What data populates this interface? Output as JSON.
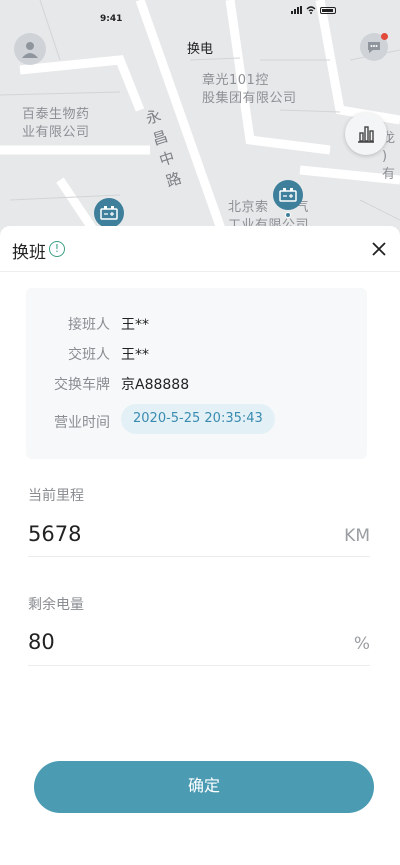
{
  "status_bar": {
    "time": "9:41"
  },
  "header": {
    "title": "换电"
  },
  "map": {
    "labels": {
      "company_baitai": "百泰生物药\n业有限公司",
      "company_zhangguang": "章光101控\n股集团有限公司",
      "company_beijing": "北京索　　气\n工业有限公司",
      "partial_right": "龙\n)有",
      "road": "永昌中路"
    }
  },
  "sheet": {
    "title": "换班",
    "info_glyph": "!",
    "rows": [
      {
        "key": "接班人",
        "value": "王**"
      },
      {
        "key": "交班人",
        "value": "王**"
      },
      {
        "key": "交换车牌",
        "value": "京A88888"
      }
    ],
    "business_time": {
      "key": "营业时间",
      "value": "2020-5-25 20:35:43"
    },
    "mileage": {
      "label": "当前里程",
      "value": "5678",
      "unit": "KM"
    },
    "battery": {
      "label": "剩余电量",
      "value": "80",
      "unit": "%"
    },
    "confirm_label": "确定"
  },
  "colors": {
    "accent": "#4b9bb3",
    "pin": "#3e7f9b",
    "badge": "#e24b3b"
  }
}
